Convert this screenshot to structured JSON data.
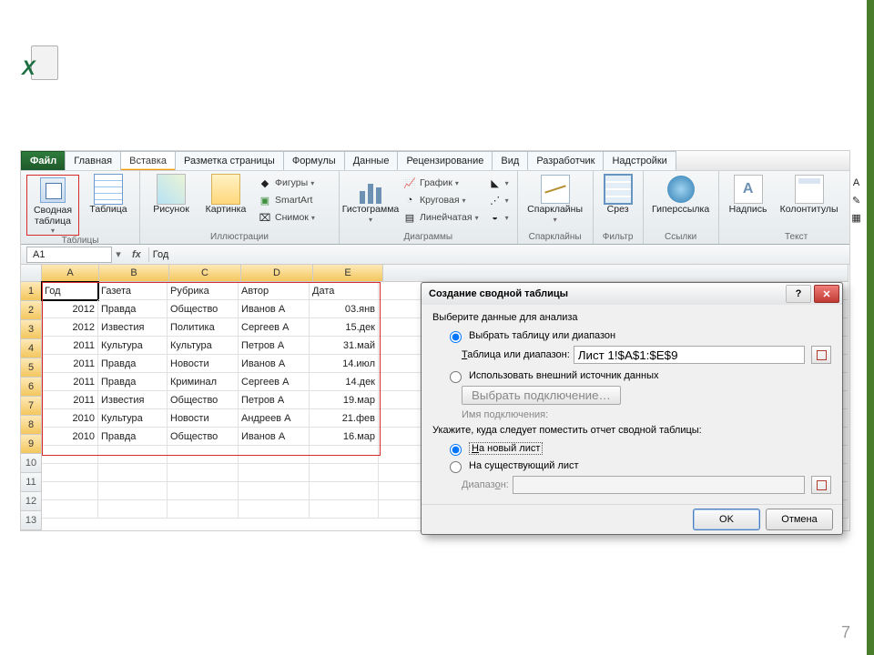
{
  "page_number": "7",
  "ribbon": {
    "tabs": [
      "Файл",
      "Главная",
      "Вставка",
      "Разметка страницы",
      "Формулы",
      "Данные",
      "Рецензирование",
      "Вид",
      "Разработчик",
      "Надстройки"
    ],
    "active_tab": "Вставка",
    "groups": {
      "tables": {
        "label": "Таблицы",
        "pivot": "Сводная\nтаблица",
        "table": "Таблица"
      },
      "illustrations": {
        "label": "Иллюстрации",
        "pic": "Рисунок",
        "clip": "Картинка",
        "shapes": "Фигуры",
        "smartart": "SmartArt",
        "screenshot": "Снимок"
      },
      "charts": {
        "label": "Диаграммы",
        "hist": "Гистограмма",
        "line": "График",
        "pie": "Круговая",
        "bar": "Линейчатая"
      },
      "sparklines": {
        "label": "Спарклайны",
        "btn": "Спарклайны"
      },
      "filter": {
        "label": "Фильтр",
        "slicer": "Срез"
      },
      "links": {
        "label": "Ссылки",
        "hyperlink": "Гиперссылка"
      },
      "text": {
        "label": "Текст",
        "textbox": "Надпись",
        "headerfooter": "Колонтитулы"
      }
    }
  },
  "name_box": "A1",
  "fx_label": "fx",
  "formula_value": "Год",
  "columns": [
    "A",
    "B",
    "C",
    "D",
    "E"
  ],
  "table": {
    "headers": [
      "Год",
      "Газета",
      "Рубрика",
      "Автор",
      "Дата"
    ],
    "rows": [
      [
        "2012",
        "Правда",
        "Общество",
        "Иванов А",
        "03.янв"
      ],
      [
        "2012",
        "Известия",
        "Политика",
        "Сергеев А",
        "15.дек"
      ],
      [
        "2011",
        "Культура",
        "Культура",
        "Петров А",
        "31.май"
      ],
      [
        "2011",
        "Правда",
        "Новости",
        "Иванов А",
        "14.июл"
      ],
      [
        "2011",
        "Правда",
        "Криминал",
        "Сергеев А",
        "14.дек"
      ],
      [
        "2011",
        "Известия",
        "Общество",
        "Петров А",
        "19.мар"
      ],
      [
        "2010",
        "Культура",
        "Новости",
        "Андреев А",
        "21.фев"
      ],
      [
        "2010",
        "Правда",
        "Общество",
        "Иванов А",
        "16.мар"
      ]
    ]
  },
  "dialog": {
    "title": "Создание сводной таблицы",
    "section1": "Выберите данные для анализа",
    "opt_select_range": "Выбрать таблицу или диапазон",
    "range_label": "Таблица или диапазон:",
    "range_value": "Лист 1!$A$1:$E$9",
    "opt_external": "Использовать внешний источник данных",
    "choose_conn": "Выбрать подключение…",
    "conn_name_label": "Имя подключения:",
    "section2": "Укажите, куда следует поместить отчет сводной таблицы:",
    "opt_new_sheet": "На новый лист",
    "opt_existing": "На существующий лист",
    "dest_range_label": "Диапазон:",
    "ok": "OK",
    "cancel": "Отмена",
    "help": "?",
    "close": "✕"
  }
}
